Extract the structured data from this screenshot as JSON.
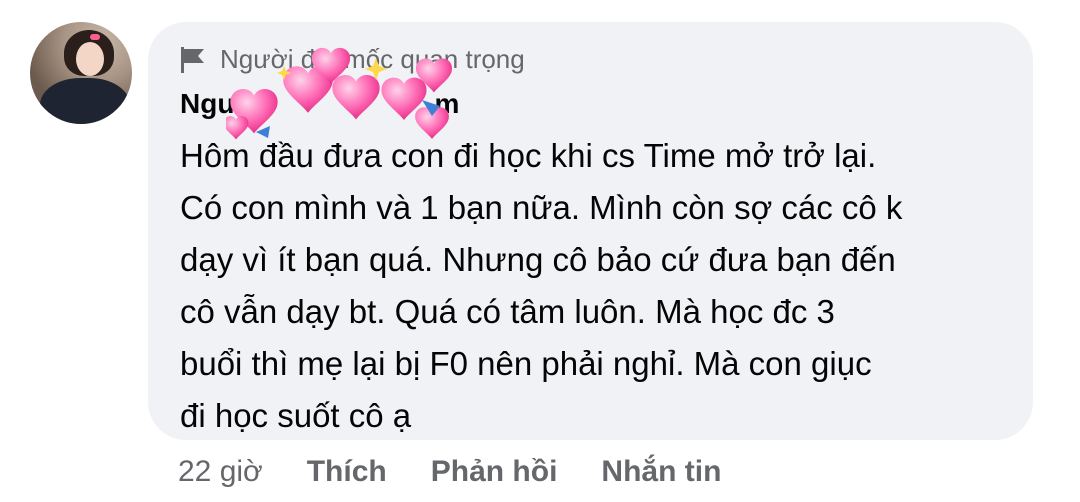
{
  "comment": {
    "badge_text": "Người đạt mốc quan trọng",
    "author_start": "Ngu",
    "author_end": "m",
    "text_lines": [
      "Hôm đầu đưa con đi học khi cs Time mở trở lại.",
      "Có con mình và 1 bạn nữa. Mình còn sợ các cô k",
      "dạy vì ít bạn quá. Nhưng cô bảo cứ đưa bạn đến",
      "cô vẫn dạy bt. Quá có tâm luôn. Mà học đc 3",
      "buổi thì mẹ lại bị F0 nên phải nghỉ. Mà con giục",
      "đi học suốt cô ạ"
    ],
    "time": "22 giờ",
    "like_label": "Thích",
    "reply_label": "Phản hồi",
    "message_label": "Nhắn tin"
  },
  "colors": {
    "bubble": "#f0f2f5",
    "secondary_text": "#65676b",
    "hearts": "#ff4fa3"
  },
  "icons": {
    "badge": "flag-icon",
    "overlay": "hearts-sticker"
  }
}
